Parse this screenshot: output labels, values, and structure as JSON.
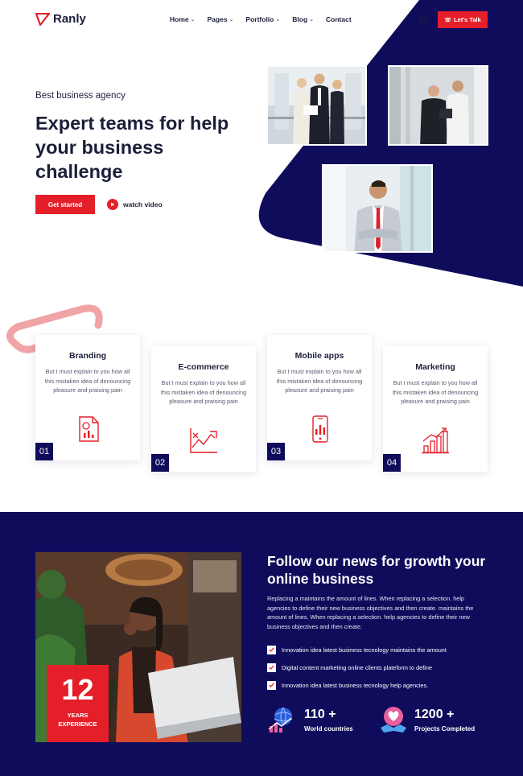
{
  "header": {
    "brand": "Ranly",
    "nav": [
      {
        "label": "Home",
        "has_dropdown": true
      },
      {
        "label": "Pages",
        "has_dropdown": true
      },
      {
        "label": "Portfolio",
        "has_dropdown": true
      },
      {
        "label": "Blog",
        "has_dropdown": true
      },
      {
        "label": "Contact",
        "has_dropdown": false
      }
    ],
    "cta_label": "Let's Talk"
  },
  "hero": {
    "subtitle": "Best business agency",
    "title": "Expert teams for help your business challenge",
    "primary_button": "Get started",
    "video_link": "watch video"
  },
  "services": [
    {
      "title": "Branding",
      "text": "But I must explain to you how all this mistaken idea of denouncing pleasure and praising pain",
      "number": "01",
      "icon": "document-chart-icon"
    },
    {
      "title": "E-commerce",
      "text": "But I must explain to you how all this mistaken idea of denouncing pleasure and praising pain",
      "number": "02",
      "icon": "growth-arrow-chart-icon"
    },
    {
      "title": "Mobile apps",
      "text": "But I must explain to you how all this mistaken idea of denouncing pleasure and praising pain",
      "number": "03",
      "icon": "mobile-chart-icon"
    },
    {
      "title": "Marketing",
      "text": "But I must explain to you how all this mistaken idea of denouncing pleasure and praising pain",
      "number": "04",
      "icon": "bar-growth-icon"
    }
  ],
  "news": {
    "title": "Follow our news for growth your online business",
    "body": "Replacing a maintains the amount of lines. When replacing a selection. help agencies to define their new business objectives and then create. maintains the amount of lines. When replacing a selection. help agencies to define their new business objectives and then create.",
    "checks": [
      "Innovation idea latest business tecnology maintains the amount",
      "Digital content marketing online clients plateform to define",
      "Innovation idea latest business tecnology help agencies."
    ],
    "experience": {
      "number": "12",
      "label_line1": "YEARS",
      "label_line2": "EXPERIENCE"
    },
    "stats": [
      {
        "number": "110 +",
        "label": "World countries",
        "icon": "globe-chart-icon"
      },
      {
        "number": "1200 +",
        "label": "Projects Completed",
        "icon": "handshake-heart-icon"
      }
    ]
  },
  "colors": {
    "brand_red": "#e51f2a",
    "navy": "#0f0c5b",
    "text_dark": "#1c1f3a"
  }
}
